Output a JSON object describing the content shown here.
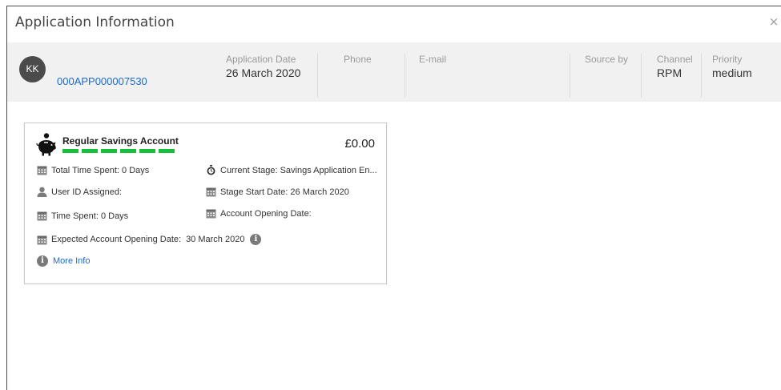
{
  "header": {
    "title": "Application Information",
    "close_label": "×"
  },
  "applicant": {
    "initials": "KK",
    "application_id": "000APP000007530",
    "application_date_label": "Application Date",
    "application_date": "26 March 2020",
    "phone_label": "Phone",
    "phone": "",
    "email_label": "E-mail",
    "email": "",
    "source_label": "Source by",
    "source": "",
    "channel_label": "Channel",
    "channel": "RPM",
    "priority_label": "Priority",
    "priority": "medium"
  },
  "card": {
    "product_name": "Regular Savings Account",
    "progress_segments": 6,
    "amount": "£0.00",
    "total_time_spent": "Total Time Spent: 0 Days",
    "current_stage": "Current Stage: Savings Application En...",
    "user_id_assigned": "User ID Assigned:",
    "stage_start_date": "Stage Start Date: 26 March 2020",
    "time_spent": "Time Spent: 0 Days",
    "account_opening_date": "Account Opening Date:",
    "expected_opening_label": "Expected Account Opening Date:",
    "expected_opening_date": "30 March 2020",
    "more_info": "More Info"
  },
  "colors": {
    "accent": "#1b6ad1",
    "progress": "#16c03a",
    "info_bar_bg": "#f1f1f1"
  },
  "icons": [
    "close-icon",
    "piggy-bank-icon",
    "calendar-icon",
    "stopwatch-icon",
    "user-icon",
    "info-icon"
  ]
}
